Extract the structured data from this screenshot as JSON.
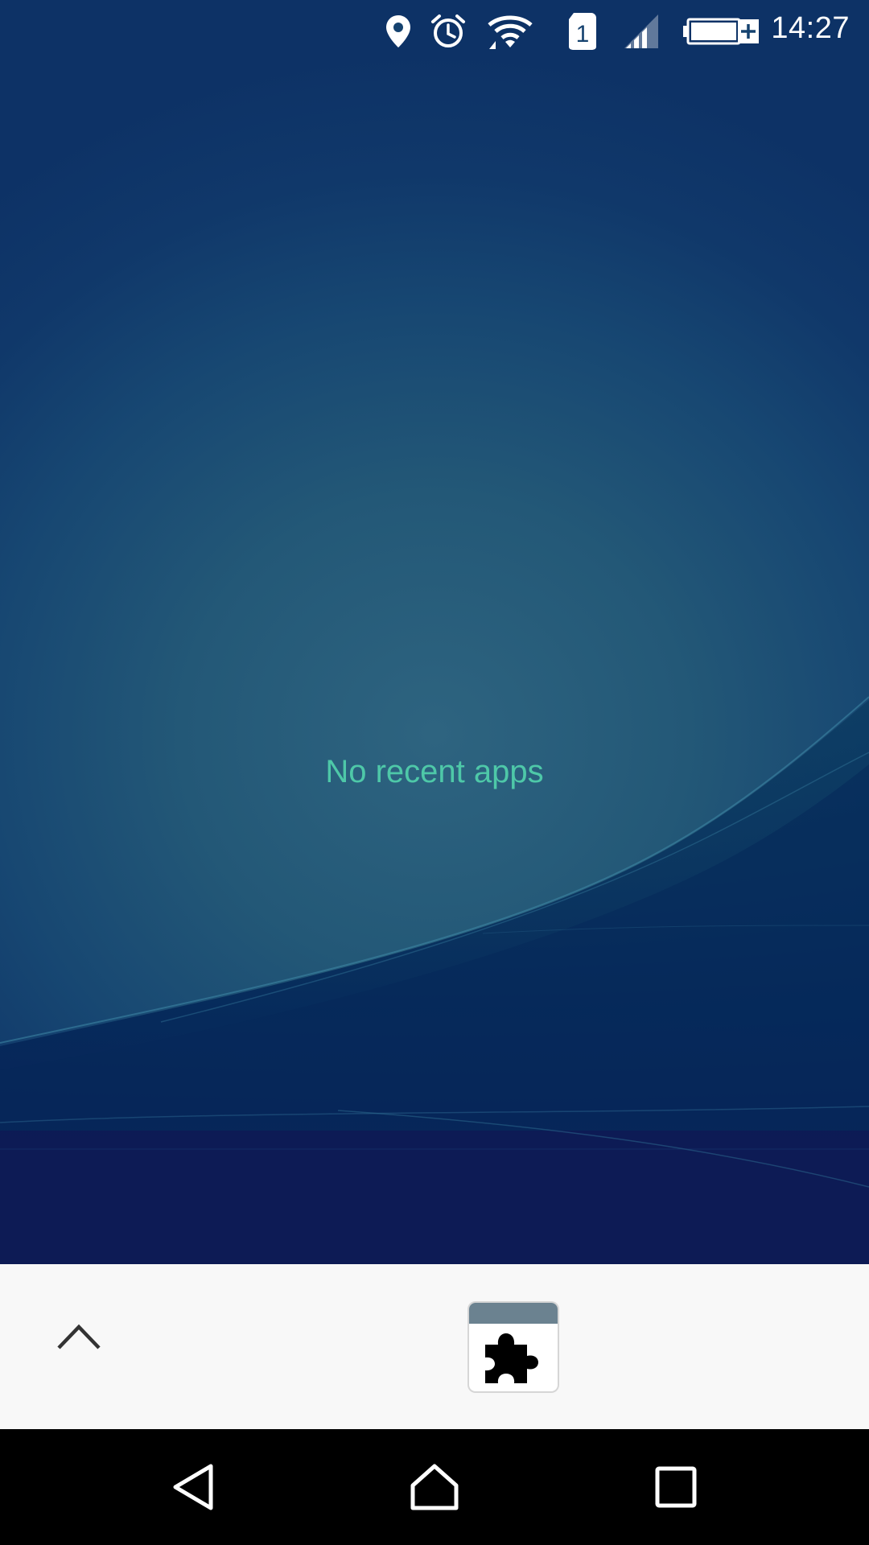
{
  "status_bar": {
    "time": "14:27",
    "icons": [
      "location-icon",
      "alarm-icon",
      "wifi-icon",
      "sim-1-icon",
      "signal-icon",
      "battery-charging-icon"
    ],
    "sim_label": "1"
  },
  "recents": {
    "empty_message": "No recent apps"
  },
  "dock": {
    "expand_icon": "chevron-up-icon",
    "app_icon": "puzzle-piece-icon"
  },
  "nav_bar": {
    "buttons": [
      "back-icon",
      "home-icon",
      "recents-icon"
    ]
  },
  "colors": {
    "accent_text": "#4ec8a8",
    "dock_background": "#f8f8f8",
    "nav_background": "#000000"
  }
}
